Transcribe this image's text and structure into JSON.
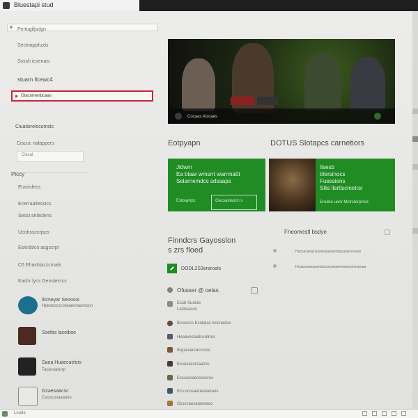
{
  "window": {
    "title": "Bluestapi stud"
  },
  "sidebar": {
    "address": "",
    "items": [
      {
        "label": "Pertogifjsdgn"
      },
      {
        "label": "Sectnapphzds"
      },
      {
        "label": "Ssssh icsenais"
      },
      {
        "label": "stuarn llcewc4"
      },
      {
        "label": "Gtacnmenbcaas"
      }
    ],
    "filter_heading": "Ciuatiorelscomstc",
    "filter_label": "Ciscuc nalappers",
    "filter_value": "Ciscul",
    "section_title": "Piccy",
    "list": [
      {
        "label": "Eraniclecs"
      },
      {
        "label": "Ecerraallesstcs"
      },
      {
        "label": "Sessi selaclens"
      },
      {
        "label": "Ucohssccrjscs"
      },
      {
        "label": "Eskrdslco asgscrpl"
      },
      {
        "label": "C6 Ehashlazzcrnals"
      },
      {
        "label": "Kashr lycs Genstecrcs"
      }
    ],
    "friends": [
      {
        "name": "Ilsmeyar Seoosoi",
        "sub": "Hpeacocsciswaeuhaarsocn"
      },
      {
        "name": "Ssefas laceibse",
        "sub": ""
      },
      {
        "name": "Saoa Huaecueleis",
        "sub": "Tacisroalsrrp"
      },
      {
        "name": "Gcaesaacsc",
        "sub": "Cscucusaaaoes"
      }
    ]
  },
  "hero": {
    "bar_label": "Cocaas Alzoaes"
  },
  "sections": {
    "left_heading": "Eotpyapn",
    "right_heading": "DOTUS Slotapcs carnetiors"
  },
  "card_left": {
    "lines": [
      "Jldwm",
      "Ea blaar wmsrrt warrmattt",
      "Selarnemdcs sdsaaps"
    ],
    "btn_left": "Esloaynpc",
    "btn_right": "Oacsaslaocn s"
  },
  "card_right": {
    "lines": [
      "Ilsesb",
      "trlersinocs",
      "Fuessiens",
      "Sllis llsrtlscmetrsr"
    ],
    "btn": "Erodse uenr Mctrsterprrsd"
  },
  "feed": {
    "heading_line1": "Finndcrs Gayosslon",
    "heading_line2": "s zrs floed",
    "primary": "DODL2S3eraroals",
    "title": "Ofusser @ oelas",
    "rows": [
      {
        "label": "Ecsb Suaras",
        "sub": "Lsdnsasos"
      },
      {
        "label": "Bcccrccs Ecolatas lsscrardos",
        "sub": ""
      },
      {
        "label": "Heaavestealnsrdnes",
        "sub": ""
      },
      {
        "label": "Ilsgasvarvaccorss",
        "sub": ""
      },
      {
        "label": "Ecsosacsrsaazos",
        "sub": ""
      },
      {
        "label": "Ecsccoraecesseros",
        "sub": ""
      },
      {
        "label": "Ecs.ocssaareraseraos",
        "sub": ""
      },
      {
        "label": "Gcsvcaesaraeseoo",
        "sub": ""
      }
    ]
  },
  "recent": {
    "heading": "Fheomestl bsdye",
    "rows": [
      {
        "label": "Hacsacanacsuoreusaesrerlsgsusanscouro"
      },
      {
        "label": "Hcaacaeacaanrtsarcscoeaeeressncomcseaar"
      }
    ]
  },
  "status": {
    "text": "Luuda"
  },
  "colors": {
    "accent": "#1f8c24",
    "selection": "#c3263a"
  }
}
